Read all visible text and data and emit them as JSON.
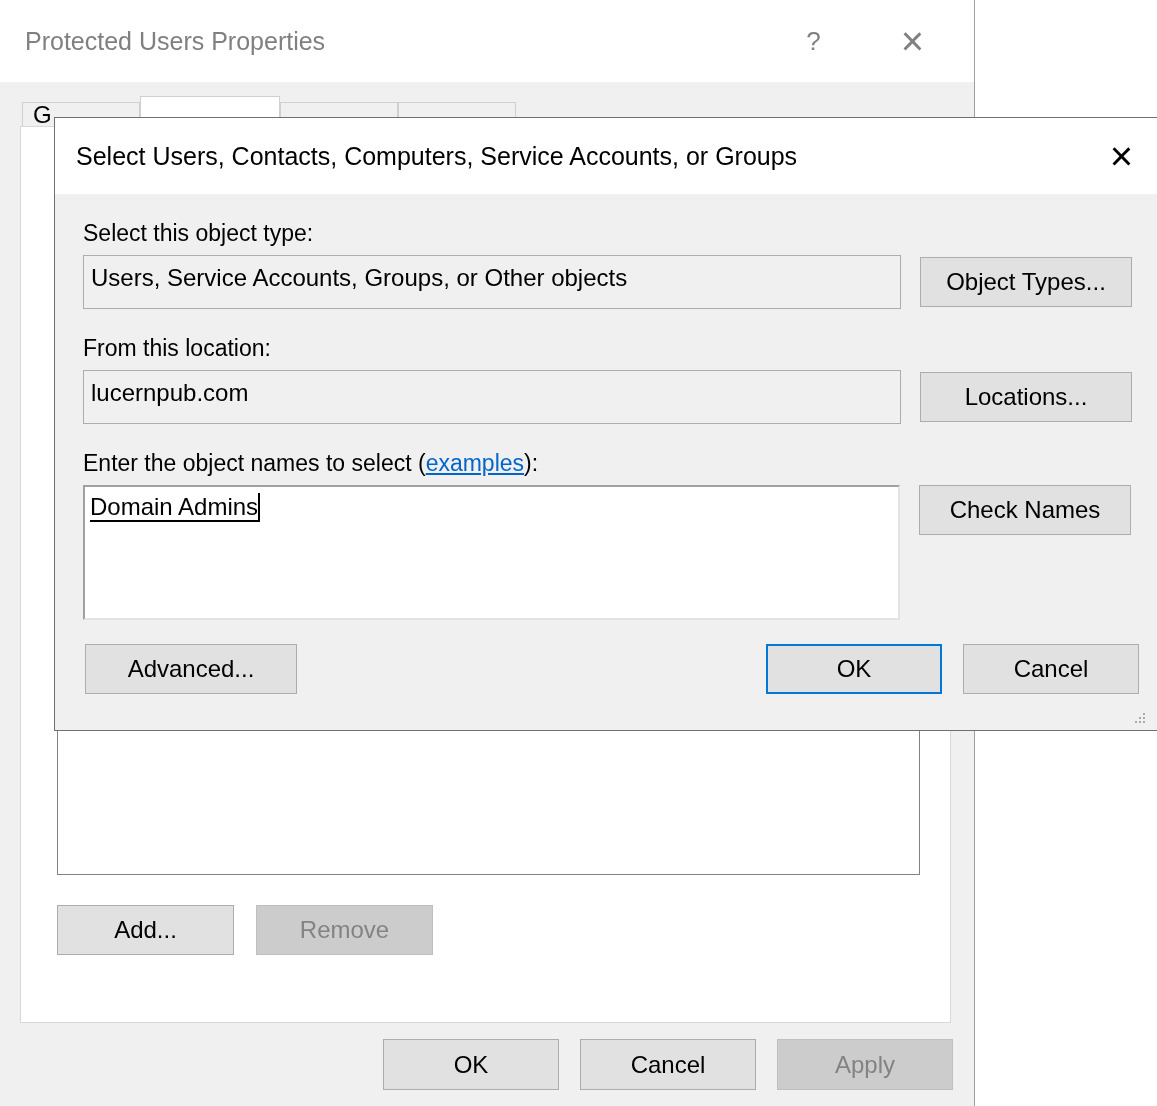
{
  "window": {
    "title": "Protected Users Properties",
    "help": "?",
    "close": "×"
  },
  "tabs": [
    {
      "label": "G",
      "selected": false
    },
    {
      "selected": true
    },
    {
      "selected": false
    },
    {
      "selected": false
    }
  ],
  "member_buttons": [
    {
      "label": "Add...",
      "disabled": false
    },
    {
      "label": "Remove",
      "disabled": true
    }
  ],
  "buttons": [
    {
      "label": "OK",
      "disabled": false
    },
    {
      "label": "Cancel",
      "disabled": false
    },
    {
      "label": "Apply",
      "disabled": true
    }
  ],
  "select_dialog": {
    "title": "Select Users, Contacts, Computers, Service Accounts, or Groups",
    "close": "×",
    "object_type": {
      "label": "Select this object type:",
      "value": "Users, Service Accounts, Groups, or Other objects",
      "button": "Object Types..."
    },
    "location": {
      "label": "From this location:",
      "value": "lucernpub.com",
      "button": "Locations..."
    },
    "names": {
      "label_prefix": "Enter the object names to select (",
      "link": "examples",
      "label_suffix": "):",
      "value": "Domain Admins",
      "button": "Check Names"
    },
    "advanced": "Advanced...",
    "buttons": [
      {
        "label": "OK",
        "focused": true
      },
      {
        "label": "Cancel",
        "focused": false
      }
    ]
  }
}
